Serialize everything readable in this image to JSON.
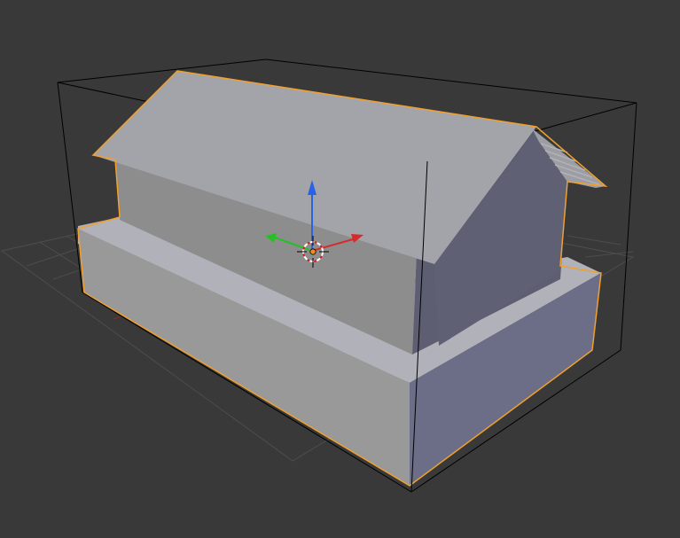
{
  "app": "3D viewport",
  "viewport": {
    "background": "#393939",
    "grid_color": "#4d4d4d",
    "x_axis_color": "#8e2a2a",
    "selection_outline_color": "#f0a030",
    "bounds_color": "#000000"
  },
  "object": {
    "kind": "house-model",
    "selected": true,
    "faces": {
      "roof_top": "#a3a4a9",
      "roof_side": "#9d9ea3",
      "wall_front": "#8d8d8d",
      "wall_side": "#5d5e72",
      "gable": "#5f6074",
      "base_front": "#999999",
      "base_top": "#b1b1b9",
      "base_side": "#707188",
      "base_side_front": "#6c6d86"
    }
  },
  "gizmo": {
    "z_arrow_color": "#2a62e6",
    "x_arrow_color": "#d52b2b",
    "y_arrow_color": "#26c026",
    "pivot_color": "#f08a1a",
    "cursor_icon": "3d-cursor-icon"
  }
}
